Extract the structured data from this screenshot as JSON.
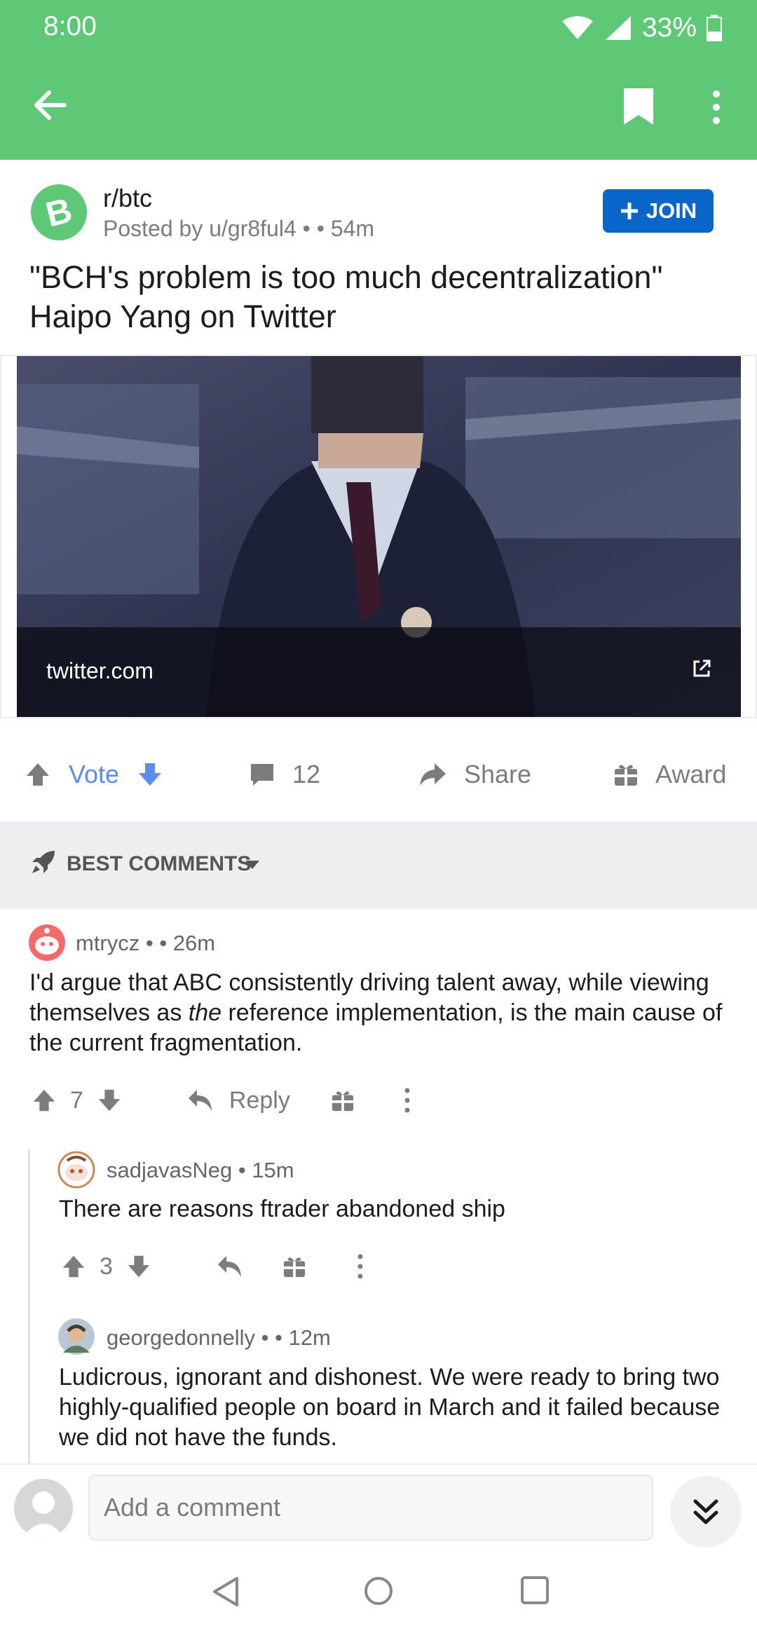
{
  "status": {
    "time": "8:00",
    "battery": "33%"
  },
  "toolbar": {
    "back_icon": "arrow-left-icon",
    "save_icon": "bookmark-icon",
    "more_icon": "more-vertical-icon"
  },
  "post": {
    "subreddit": "r/btc",
    "posted_by": "Posted by u/gr8ful4",
    "time": "54m",
    "join_label": "JOIN",
    "title": "\"BCH's problem is too much decentralization\" Haipo Yang on Twitter",
    "link_domain": "twitter.com"
  },
  "actions": {
    "vote_label": "Vote",
    "comments_count": "12",
    "share_label": "Share",
    "award_label": "Award"
  },
  "sort": {
    "label": "BEST COMMENTS"
  },
  "comments": [
    {
      "author": "mtrycz",
      "time": "26m",
      "body_before": "I'd argue that ABC consistently driving talent away, while viewing themselves as ",
      "body_emph": "the",
      "body_after": " reference implementation, is the main cause of the current fragmentation.",
      "score": "7",
      "reply_label": "Reply"
    },
    {
      "author": "sadjavasNeg",
      "time": "15m",
      "body": "There are reasons ftrader abandoned ship",
      "score": "3"
    },
    {
      "author": "georgedonnelly",
      "time": "12m",
      "body": "Ludicrous, ignorant and dishonest. We were ready to bring two highly-qualified people on board in March and it failed because we did not have the funds."
    }
  ],
  "comment_box": {
    "placeholder": "Add a comment"
  },
  "colors": {
    "appbar": "#5ec877",
    "join": "#0a66c8",
    "vote_blue": "#5b8def",
    "sort_bg": "#edeef0"
  }
}
